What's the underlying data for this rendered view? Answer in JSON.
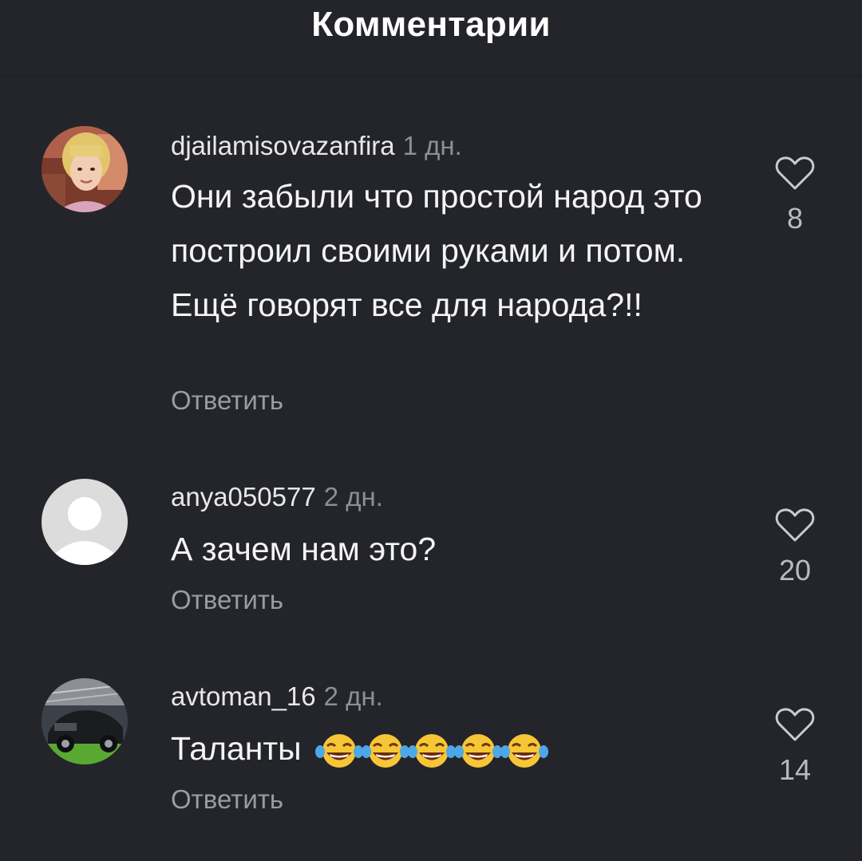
{
  "header": {
    "title": "Комментарии"
  },
  "comments": [
    {
      "username": "djailamisovazanfira",
      "time": "1 дн.",
      "text": "Они забыли что простой народ это построил своими руками и потом. Ещё говорят все для народа?!!",
      "reply_label": "Ответить",
      "likes": "8"
    },
    {
      "username": "anya050577",
      "time": "2 дн.",
      "text": "А зачем нам это?",
      "reply_label": "Ответить",
      "likes": "20"
    },
    {
      "username": "avtoman_16",
      "time": "2 дн.",
      "text": "Таланты",
      "emoji_icons": [
        "tears-of-joy-emoji",
        "tears-of-joy-emoji",
        "tears-of-joy-emoji",
        "tears-of-joy-emoji",
        "tears-of-joy-emoji"
      ],
      "reply_label": "Ответить",
      "likes": "14"
    }
  ],
  "colors": {
    "background": "#24252b",
    "text": "#f4f4f4",
    "muted": "#8d8f95",
    "reply": "#9a9ca1"
  }
}
